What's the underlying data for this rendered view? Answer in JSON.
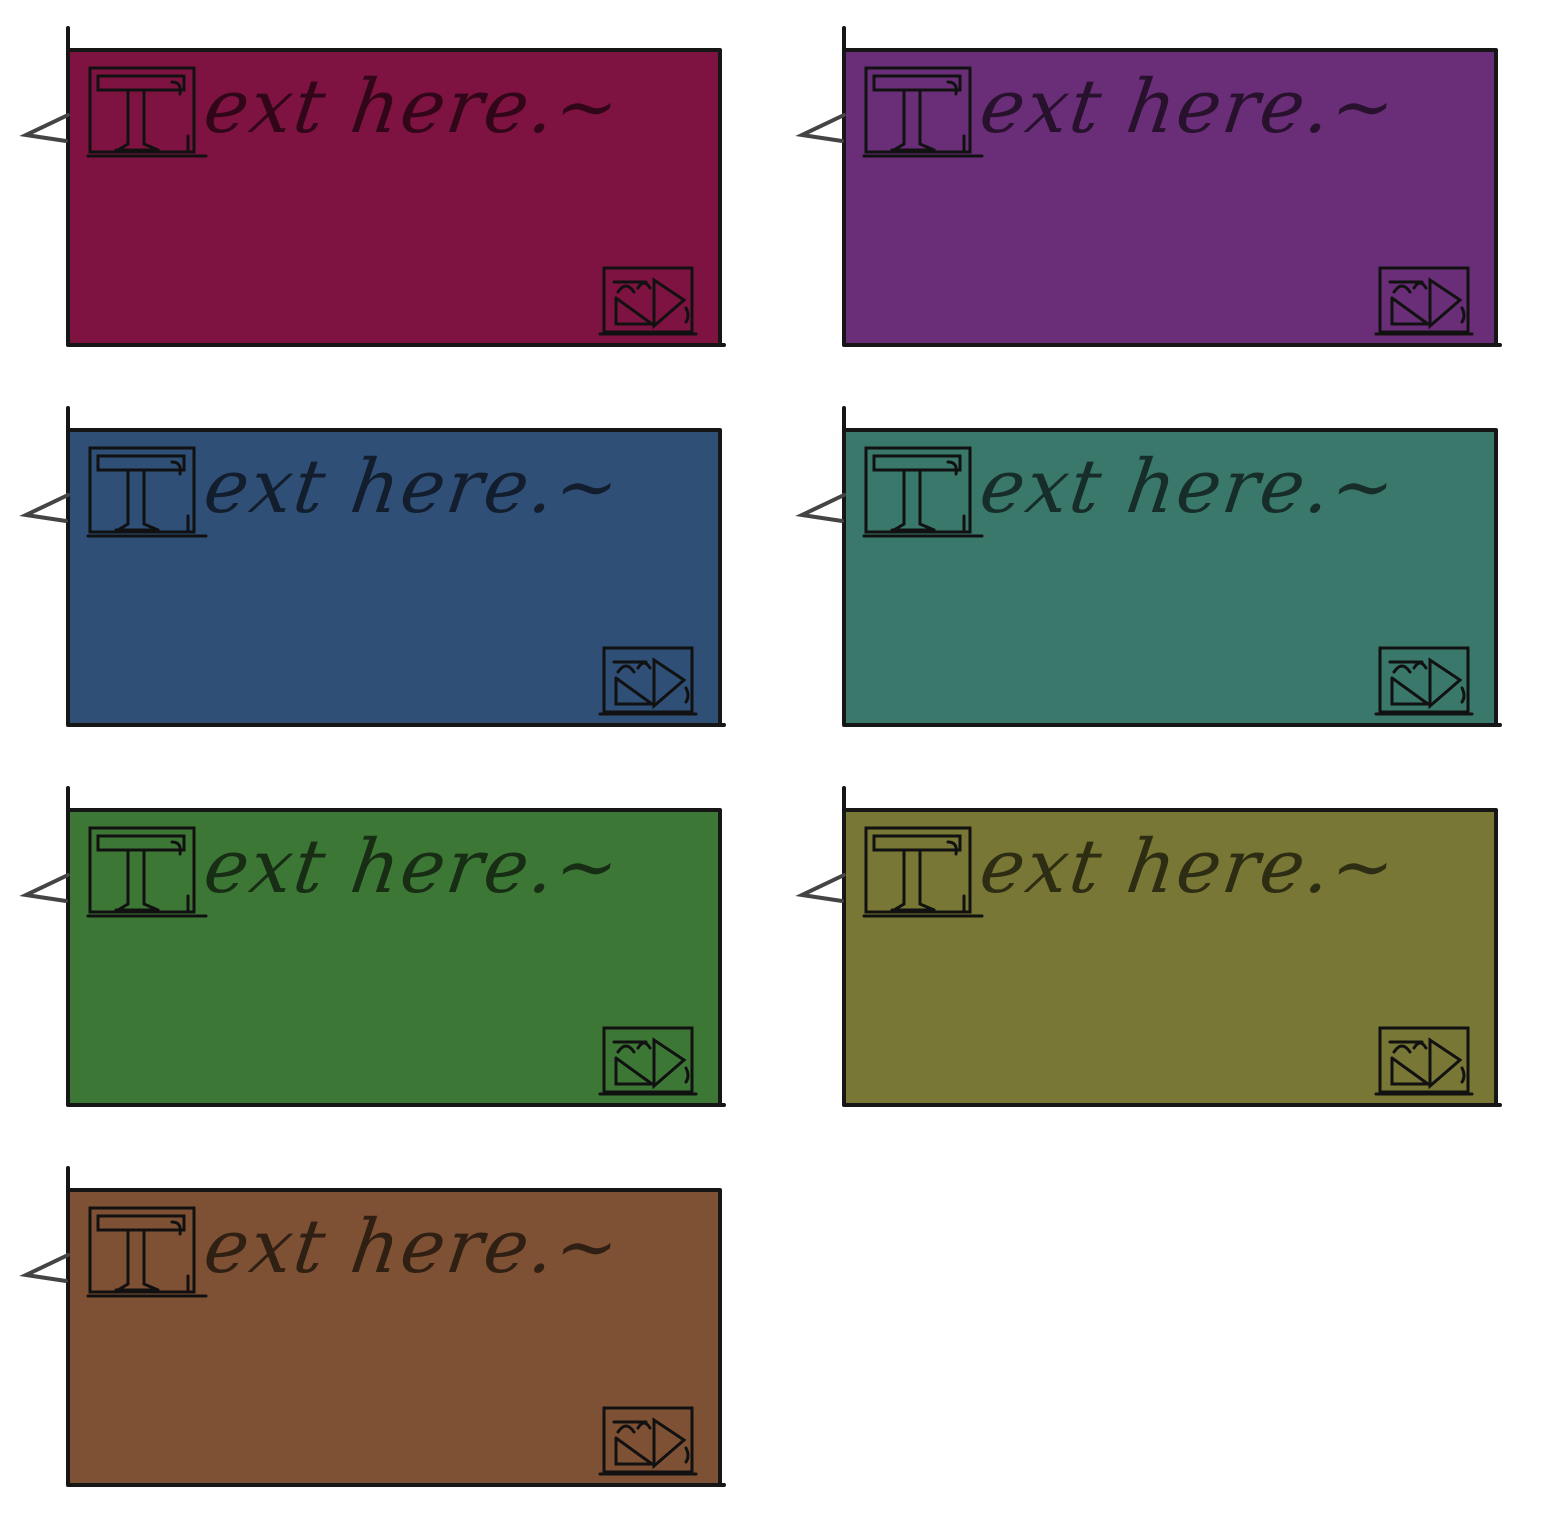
{
  "placeholder_text": "ext here.~",
  "cards": [
    {
      "name": "crimson",
      "color": "#7e1240"
    },
    {
      "name": "purple",
      "color": "#6a2e78"
    },
    {
      "name": "blue",
      "color": "#304f77"
    },
    {
      "name": "teal",
      "color": "#3a786c"
    },
    {
      "name": "green",
      "color": "#3d7736"
    },
    {
      "name": "olive",
      "color": "#787735"
    },
    {
      "name": "brown",
      "color": "#7f5134"
    }
  ],
  "icons": {
    "text_tool": "text-tool-icon",
    "media": "media-icon"
  }
}
